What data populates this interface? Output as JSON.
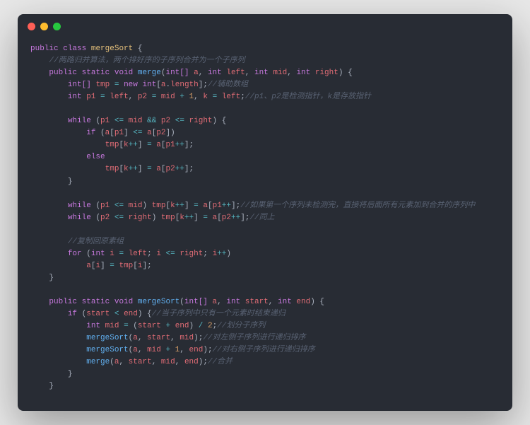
{
  "window": {
    "dots": [
      "red",
      "yellow",
      "green"
    ]
  },
  "code": {
    "t": {
      "public": "public",
      "class": "class",
      "clsName": "mergeSort",
      "static": "static",
      "void": "void",
      "int": "int",
      "intArr": "int[]",
      "new": "new",
      "if": "if",
      "else": "else",
      "while": "while",
      "for": "for",
      "merge": "merge",
      "mergeSortFn": "mergeSort",
      "a": "a",
      "left": "left",
      "right": "right",
      "mid": "mid",
      "tmp": "tmp",
      "p1": "p1",
      "p2": "p2",
      "k": "k",
      "i": "i",
      "start": "start",
      "end": "end",
      "length": "length",
      "n1": "1",
      "n2": "2"
    },
    "cm": {
      "c1": "//两路归并算法，两个排好序的子序列合并为一个子序列",
      "c2": "//辅助数组",
      "c3": "//p1、p2是检测指针，k是存放指针",
      "c4": "//如果第一个序列未检测完，直接将后面所有元素加到合并的序列中",
      "c5": "//同上",
      "c6": "//复制回原素组",
      "c7": "//当子序列中只有一个元素时结束递归",
      "c8": "//划分子序列",
      "c9": "//对左侧子序列进行递归排序",
      "c10": "//对右侧子序列进行递归排序",
      "c11": "//合并"
    }
  }
}
